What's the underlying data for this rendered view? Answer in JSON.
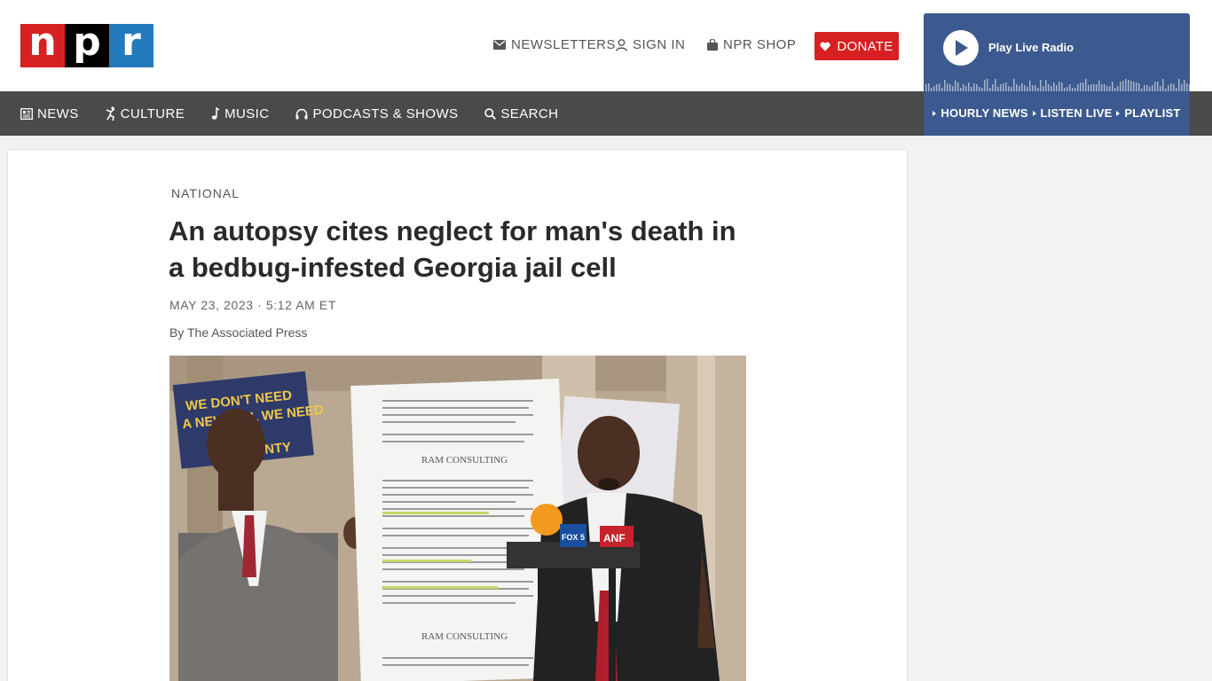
{
  "brand": {
    "letters": [
      "n",
      "p",
      "r"
    ],
    "colors": [
      "#d62021",
      "#000000",
      "#237bbd"
    ]
  },
  "header": {
    "newsletters": "NEWSLETTERS",
    "sign_in": "SIGN IN",
    "shop": "NPR SHOP",
    "donate": "DONATE"
  },
  "player": {
    "label": "Play Live Radio",
    "links": [
      "HOURLY NEWS",
      "LISTEN LIVE",
      "PLAYLIST"
    ],
    "color": "#3c5a8f"
  },
  "nav": {
    "items": [
      {
        "label": "NEWS",
        "icon": "newspaper-icon"
      },
      {
        "label": "CULTURE",
        "icon": "dancer-icon"
      },
      {
        "label": "MUSIC",
        "icon": "music-note-icon"
      },
      {
        "label": "PODCASTS & SHOWS",
        "icon": "headphones-icon"
      },
      {
        "label": "SEARCH",
        "icon": "search-icon"
      }
    ]
  },
  "article": {
    "section": "NATIONAL",
    "headline": "An autopsy cites neglect for man's death in a bedbug-infested Georgia jail cell",
    "date": "MAY 23, 2023 · 5:12 AM ET",
    "byline": "By The Associated Press",
    "photo": {
      "sign_text": "WE DON'T NEED A NEW JAIL WE NEED A NEW SHERIFF FULTON COUNTY",
      "board_logo": "RAM CONSULTING",
      "mic_flags": [
        "FOX 5",
        "ANF"
      ]
    }
  }
}
